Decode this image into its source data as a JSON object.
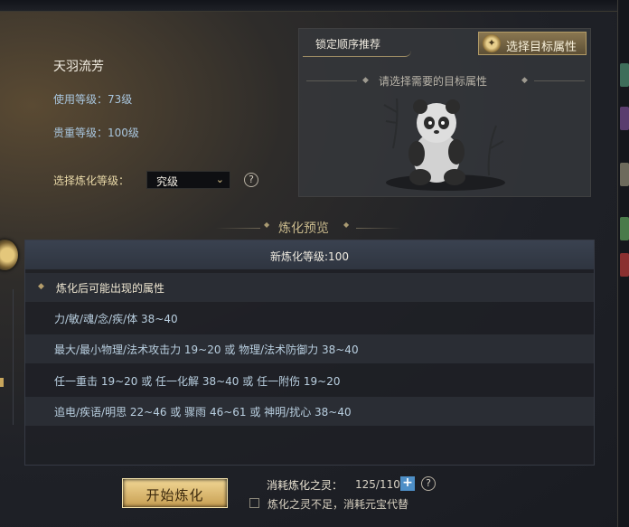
{
  "info": {
    "title": "天羽流芳",
    "use_level": "使用等级：73级",
    "value_level": "贵重等级：100级",
    "refine_label": "选择炼化等级：",
    "refine_value": "究级",
    "help_icon": "?"
  },
  "recommend": {
    "title": "锁定顺序推荐",
    "button_label": "选择目标属性",
    "hint": "请选择需要的目标属性"
  },
  "preview": {
    "title": "炼化预览",
    "new_level": "新炼化等级:100",
    "attr_heading": "炼化后可能出现的属性",
    "rows": [
      "力/敏/魂/念/疾/体 38~40",
      "最大/最小物理/法术攻击力 19~20 或 物理/法术防御力 38~40",
      "任一重击 19~20 或 任一化解 38~40 或 任一附伤 19~20",
      "追电/疾语/明思 22~46 或 骤雨 46~61 或 神明/扰心 38~40"
    ]
  },
  "footer": {
    "start_label": "开始炼化",
    "cost_label": "消耗炼化之灵：",
    "cost_value": "125/110",
    "plus_icon": "+",
    "substitute_label": "炼化之灵不足，消耗元宝代替"
  },
  "colors": {
    "gold_button": "#e3c27a",
    "attr_text": "#b9cfe0",
    "plus_button": "#4e8fc7"
  }
}
